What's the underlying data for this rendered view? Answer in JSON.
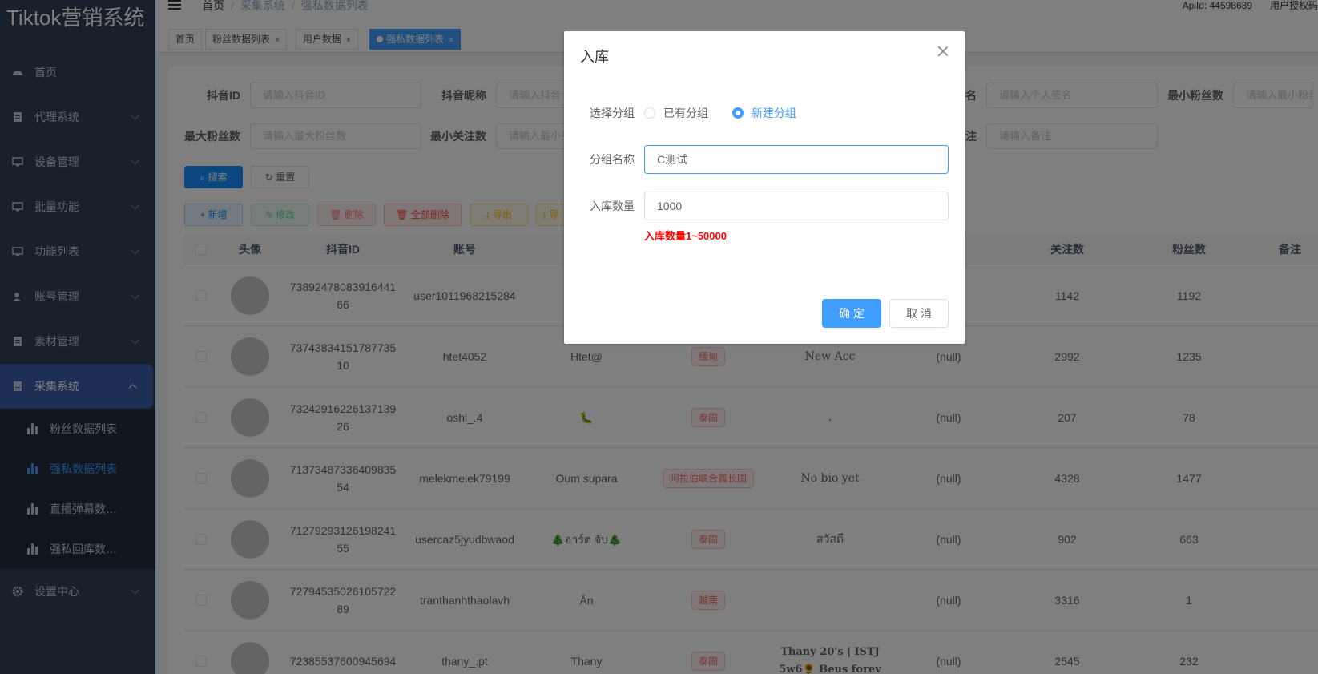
{
  "app": {
    "title": "Tiktok营销系统"
  },
  "sidebar": {
    "items": [
      {
        "label": "首页",
        "icon": "dashboard-icon"
      },
      {
        "label": "代理系统",
        "icon": "document-icon"
      },
      {
        "label": "设备管理",
        "icon": "monitor-icon"
      },
      {
        "label": "批量功能",
        "icon": "monitor-icon"
      },
      {
        "label": "功能列表",
        "icon": "monitor-icon"
      },
      {
        "label": "账号管理",
        "icon": "user-icon"
      },
      {
        "label": "素材管理",
        "icon": "document-icon"
      },
      {
        "label": "采集系统",
        "icon": "document-icon"
      },
      {
        "label": "设置中心",
        "icon": "gear-icon"
      }
    ],
    "submenu": [
      {
        "label": "粉丝数据列表"
      },
      {
        "label": "强私数据列表"
      },
      {
        "label": "直播弹幕数…"
      },
      {
        "label": "强私回库数…"
      }
    ]
  },
  "header": {
    "breadcrumb": [
      "首页",
      "采集系统",
      "强私数据列表"
    ],
    "apiid": "ApiId: 44598689",
    "auth": "用户授权码"
  },
  "tags": [
    {
      "label": "首页"
    },
    {
      "label": "粉丝数据列表",
      "close": "×"
    },
    {
      "label": "用户数据",
      "close": "×"
    },
    {
      "label": "强私数据列表",
      "close": "×"
    }
  ],
  "filters": {
    "douyin_id": {
      "label": "抖音ID",
      "placeholder": "请输入抖音ID"
    },
    "nickname": {
      "label": "抖音昵称",
      "placeholder": "请输入抖音"
    },
    "signature": {
      "label": "名",
      "placeholder": "请输入个人签名"
    },
    "min_fans": {
      "label": "最小粉丝数",
      "placeholder": "请输入最小粉丝"
    },
    "max_fans": {
      "label": "最大粉丝数",
      "placeholder": "请输入最大粉丝数"
    },
    "min_follow": {
      "label": "最小关注数",
      "placeholder": "请输入最小关"
    },
    "remark": {
      "label": "注",
      "placeholder": "请输入备注"
    }
  },
  "buttons": {
    "search": "搜索",
    "reset": "重置",
    "add": "新增",
    "edit": "修改",
    "delete": "删除",
    "delete_all": "全部删除",
    "export": "导出",
    "export2": "导"
  },
  "table": {
    "columns": [
      "头像",
      "抖音ID",
      "账号",
      "关注数",
      "粉丝数",
      "备注"
    ],
    "rows": [
      {
        "id1": "73892478083916441",
        "id2": "66",
        "account": "user1011968215284",
        "nickname": "",
        "region": "",
        "signature": "",
        "remark": "",
        "follow": "1142",
        "fans": "1192"
      },
      {
        "id1": "73743834151787735",
        "id2": "10",
        "account": "htet4052",
        "nickname": "Htet@",
        "region": "缅甸",
        "signature": "New Acc",
        "remark": "(null)",
        "follow": "2992",
        "fans": "1235"
      },
      {
        "id1": "73242916226137139",
        "id2": "26",
        "account": "oshi_.4",
        "nickname": "🐛",
        "region": "泰国",
        "signature": ".",
        "remark": "(null)",
        "follow": "207",
        "fans": "78"
      },
      {
        "id1": "71373487336409835",
        "id2": "54",
        "account": "melekmelek79199",
        "nickname": "Oum supara",
        "region": "阿拉伯联合酋长国",
        "signature": "No bio yet",
        "remark": "(null)",
        "follow": "4328",
        "fans": "1477"
      },
      {
        "id1": "71279293126198241",
        "id2": "55",
        "account": "usercaz5jyudbwaod",
        "nickname": "🎄อาร์ต จับ🎄",
        "region": "泰国",
        "signature": "สวัสดี",
        "remark": "(null)",
        "follow": "902",
        "fans": "663"
      },
      {
        "id1": "72794535026105722",
        "id2": "89",
        "account": "tranthanhthaolavh",
        "nickname": "Ân",
        "region": "越南",
        "signature": "",
        "remark": "(null)",
        "follow": "3316",
        "fans": "1"
      },
      {
        "id1": "72385537600945694",
        "id2": "",
        "account": "thany_.pt",
        "nickname": "Thany",
        "region": "泰国",
        "signature": "Thany 20's | ISTJ 5w6🌻 Beus forev",
        "remark": "(null)",
        "follow": "2545",
        "fans": "232"
      }
    ]
  },
  "dialog": {
    "title": "入库",
    "group_label": "选择分组",
    "option_existing": "已有分组",
    "option_new": "新建分组",
    "name_label": "分组名称",
    "name_value": "C测试",
    "qty_label": "入库数量",
    "qty_value": "1000",
    "hint": "入库数量1~50000",
    "ok": "确 定",
    "cancel": "取 消"
  }
}
